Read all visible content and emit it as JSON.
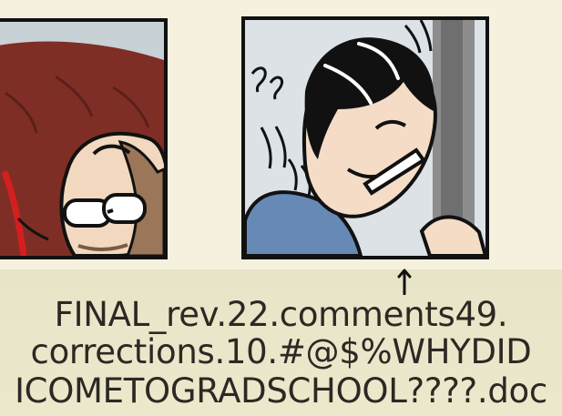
{
  "caption": {
    "line_1": "FINAL_rev.22.comments49.",
    "line_2": "corrections.10.#@$%WHYDID",
    "line_3": "ICOMETOGRADSCHOOL????.doc"
  },
  "colors": {
    "background": "#f4f0dc",
    "ink": "#111111",
    "hair_red_brown": "#7f2e25",
    "shirt_blue": "#6789b6",
    "wall_gray": "#c9d2d7"
  },
  "icons": {
    "arrow": "arrow-up-icon"
  }
}
